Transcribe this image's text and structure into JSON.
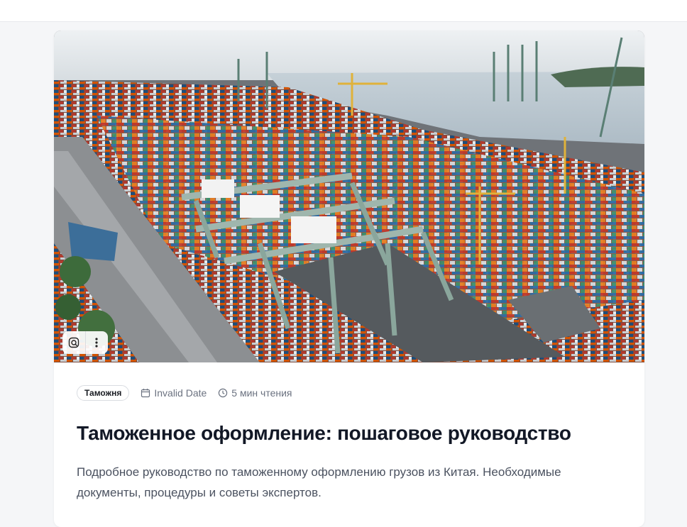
{
  "article": {
    "category": "Таможня",
    "date": "Invalid Date",
    "read_time": "5 мин чтения",
    "title": "Таможенное оформление: пошаговое руководство",
    "excerpt": "Подробное руководство по таможенному оформлению грузов из Китая. Необходимые документы, процедуры и советы экспертов."
  },
  "image": {
    "subject": "aerial view of container port with gantry cranes",
    "tools": [
      "lens-icon",
      "more-vertical-icon"
    ]
  },
  "colors": {
    "title": "#121826",
    "meta": "#6b7280",
    "body_text": "#4b5260",
    "background": "#f5f6f8"
  }
}
